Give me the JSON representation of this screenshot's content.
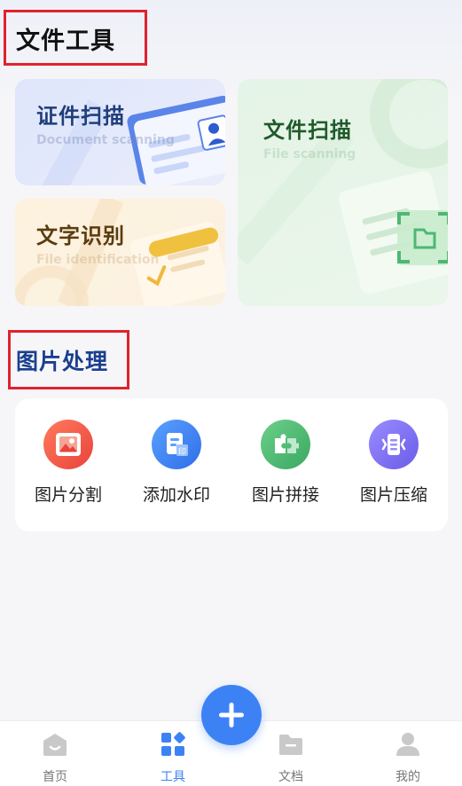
{
  "sections": {
    "file_tools_title": "文件工具",
    "image_processing_title": "图片处理"
  },
  "cards": {
    "id_scan": {
      "title": "证件扫描",
      "subtitle": "Document scanning"
    },
    "file_scan": {
      "title": "文件扫描",
      "subtitle": "File scanning"
    },
    "ocr": {
      "title": "文字识别",
      "subtitle": "File identification"
    }
  },
  "image_tools": [
    {
      "label": "图片分割",
      "icon": "image-split-icon",
      "color": "#ef5545"
    },
    {
      "label": "添加水印",
      "icon": "watermark-icon",
      "color": "#3d82f5"
    },
    {
      "label": "图片拼接",
      "icon": "puzzle-icon",
      "color": "#4cb873"
    },
    {
      "label": "图片压缩",
      "icon": "compress-icon",
      "color": "#7a6ef0"
    }
  ],
  "bottom_nav": {
    "items": [
      {
        "label": "首页",
        "icon": "home-icon"
      },
      {
        "label": "工具",
        "icon": "tools-icon"
      },
      {
        "label": "文档",
        "icon": "folder-icon"
      },
      {
        "label": "我的",
        "icon": "profile-icon"
      }
    ],
    "active_index": 1
  },
  "fab": {
    "icon": "plus-icon"
  },
  "colors": {
    "accent": "#3d82f5",
    "highlight_box": "#e0222e"
  }
}
